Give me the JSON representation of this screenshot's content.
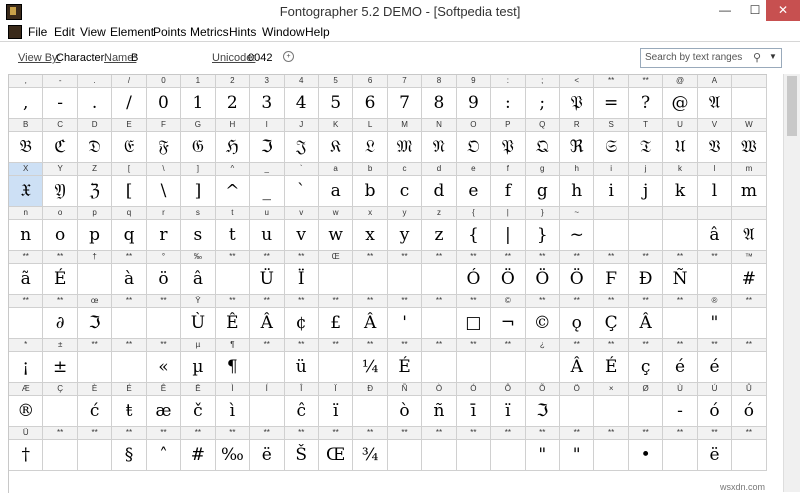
{
  "window": {
    "title": "Fontographer 5.2 DEMO - [Softpedia test]",
    "minimize": "—",
    "maximize": "☐",
    "close": "✕"
  },
  "menu": [
    "File",
    "Edit",
    "View",
    "Element",
    "Points",
    "Metrics",
    "Hints",
    "Window",
    "Help"
  ],
  "toolbar": {
    "view_by_label": "View By:",
    "view_by_value": "Character",
    "name_label": "Name:",
    "name_value": "B",
    "unicode_label": "Unicode:",
    "unicode_value": "0042",
    "search_placeholder": "Search by text ranges"
  },
  "grid": {
    "selected": [
      2,
      0
    ],
    "rows": [
      {
        "labels": [
          ",",
          "-",
          ".",
          "/",
          "0",
          "1",
          "2",
          "3",
          "4",
          "5",
          "6",
          "7",
          "8",
          "9",
          ":",
          ";",
          "<",
          "**",
          "**",
          "@",
          "A"
        ],
        "glyphs": [
          ",",
          "-",
          ".",
          "/",
          "0",
          "1",
          "2",
          "3",
          "4",
          "5",
          "6",
          "7",
          "8",
          "9",
          ":",
          ";",
          "𝔓",
          "=",
          "?",
          "@",
          "𝔄"
        ]
      },
      {
        "labels": [
          "B",
          "C",
          "D",
          "E",
          "F",
          "G",
          "H",
          "I",
          "J",
          "K",
          "L",
          "M",
          "N",
          "O",
          "P",
          "Q",
          "R",
          "S",
          "T",
          "U",
          "V",
          "W"
        ],
        "glyphs": [
          "𝔅",
          "ℭ",
          "𝔇",
          "𝔈",
          "𝔉",
          "𝔊",
          "ℌ",
          "ℑ",
          "𝔍",
          "𝔎",
          "𝔏",
          "𝔐",
          "𝔑",
          "𝔒",
          "𝔓",
          "𝔔",
          "ℜ",
          "𝔖",
          "𝔗",
          "𝔘",
          "𝔙",
          "𝔚"
        ]
      },
      {
        "labels": [
          "X",
          "Y",
          "Z",
          "[",
          "\\",
          "]",
          "^",
          "_",
          "`",
          "a",
          "b",
          "c",
          "d",
          "e",
          "f",
          "g",
          "h",
          "i",
          "j",
          "k",
          "l",
          "m"
        ],
        "glyphs": [
          "𝔛",
          "𝔜",
          "ℨ",
          "[",
          "\\",
          "]",
          "^",
          "_",
          "`",
          "a",
          "b",
          "c",
          "d",
          "e",
          "f",
          "g",
          "h",
          "i",
          "j",
          "k",
          "l",
          "m"
        ]
      },
      {
        "labels": [
          "n",
          "o",
          "p",
          "q",
          "r",
          "s",
          "t",
          "u",
          "v",
          "w",
          "x",
          "y",
          "z",
          "{",
          "|",
          "}",
          "~",
          "",
          "",
          "",
          "",
          ""
        ],
        "glyphs": [
          "n",
          "o",
          "p",
          "q",
          "r",
          "s",
          "t",
          "u",
          "v",
          "w",
          "x",
          "y",
          "z",
          "{",
          "|",
          "}",
          "~",
          "",
          "",
          "",
          "â",
          "𝔄"
        ]
      },
      {
        "labels": [
          "**",
          "**",
          "†",
          "**",
          "°",
          "‰",
          "**",
          "**",
          "**",
          "Œ",
          "**",
          "**",
          "**",
          "**",
          "**",
          "**",
          "**",
          "**",
          "**",
          "**",
          "**",
          "™"
        ],
        "glyphs": [
          "ã",
          "É",
          "",
          "à",
          "ö",
          "â",
          "",
          "Ü",
          "Ï",
          "",
          "",
          "",
          "",
          "Ó",
          "Ö",
          "Ö",
          "Ö",
          "Ϝ",
          "Ð",
          "Ñ",
          "",
          "#"
        ]
      },
      {
        "labels": [
          "**",
          "**",
          "œ",
          "**",
          "**",
          "Ÿ",
          "**",
          "**",
          "**",
          "**",
          "**",
          "**",
          "**",
          "**",
          "©",
          "**",
          "**",
          "**",
          "**",
          "**",
          "®",
          "**"
        ],
        "glyphs": [
          "",
          "∂",
          "ℑ",
          "",
          "",
          "Ù",
          "Ê",
          "Â",
          "¢",
          "£",
          "Â",
          "'",
          "",
          "□",
          "¬",
          "©",
          "ǫ",
          "Ç",
          "Â",
          "",
          "\"",
          ""
        ]
      },
      {
        "labels": [
          "*",
          "±",
          "**",
          "**",
          "**",
          "µ",
          "¶",
          "**",
          "**",
          "**",
          "**",
          "**",
          "**",
          "**",
          "**",
          "¿",
          "**",
          "**",
          "**",
          "**",
          "**",
          "**"
        ],
        "glyphs": [
          "¡",
          "±",
          "",
          "",
          "«",
          "µ",
          "¶",
          "",
          "ü",
          "",
          "¼",
          "É",
          "",
          "",
          "",
          "",
          "Â",
          "É",
          "ç",
          "é",
          "é",
          ""
        ]
      },
      {
        "labels": [
          "Æ",
          "Ç",
          "È",
          "É",
          "Ê",
          "Ë",
          "Ì",
          "Í",
          "Î",
          "Ï",
          "Ð",
          "Ñ",
          "Ò",
          "Ó",
          "Ô",
          "Õ",
          "Ö",
          "×",
          "Ø",
          "Ù",
          "Ú",
          "Û"
        ],
        "glyphs": [
          "®",
          "",
          "ć",
          "ŧ",
          "æ",
          "č",
          "ì",
          "",
          "ĉ",
          "ï",
          "",
          "ò",
          "ñ",
          "ī",
          "ï",
          "ℑ",
          "",
          "",
          "",
          "-",
          "ó",
          "ó"
        ]
      },
      {
        "labels": [
          "Ü",
          "**",
          "**",
          "**",
          "**",
          "**",
          "**",
          "**",
          "**",
          "**",
          "**",
          "**",
          "**",
          "**",
          "**",
          "**",
          "**",
          "**",
          "**",
          "**",
          "**",
          "**"
        ],
        "glyphs": [
          "†",
          "",
          "",
          "§",
          "˄",
          "#",
          "‰",
          "ë",
          "Š",
          "Œ",
          "¾",
          "",
          "",
          "",
          "",
          "\"",
          "\"",
          "",
          "•",
          "",
          "ë",
          ""
        ]
      }
    ]
  },
  "watermark": "wsxdn.com"
}
